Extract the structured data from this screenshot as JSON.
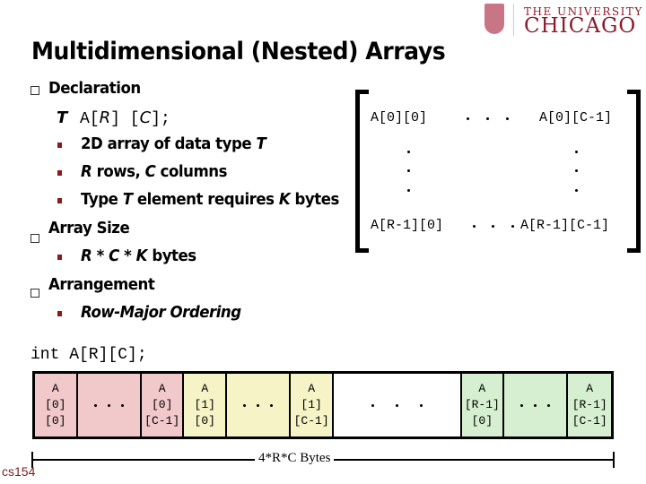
{
  "logo": {
    "top_line": "THE UNIVERSITY OF",
    "main_line": "CHICAGO",
    "brand_color": "#8b1a2e",
    "icon": "university-crest-icon"
  },
  "title": "Multidimensional (Nested) Arrays",
  "bullets": [
    {
      "label": "Declaration",
      "declaration": {
        "type": "T",
        "name": "A",
        "r": "R",
        "c": "C",
        "end": ";"
      },
      "sub": [
        {
          "text": "2D array of data type ",
          "italic": "T"
        },
        {
          "italic": "R",
          "text": " rows, ",
          "italic2": "C",
          "text2": " columns"
        },
        {
          "text": "Type ",
          "italic": "T",
          "text2": " element requires ",
          "italic2": "K",
          "text3": " bytes"
        }
      ]
    },
    {
      "label": "Array Size",
      "sub": [
        {
          "italic": "R",
          "text": " * ",
          "italic2": "C",
          "text2": " * ",
          "italic3": "K",
          "text3": " bytes"
        }
      ]
    },
    {
      "label": "Arrangement",
      "sub": [
        {
          "italic": "Row-Major Ordering"
        }
      ]
    }
  ],
  "matrix": {
    "top_left": "A[0][0]",
    "top_right": "A[0][C-1]",
    "bottom_left": "A[R-1][0]",
    "bottom_right": "A[R-1][C-1]"
  },
  "code": "int A[R][C];",
  "memory": {
    "colors": {
      "row0": "#f2c9cb",
      "row1": "#f6f3c6",
      "gap": "#ffffff",
      "rowLast": "#d6efd0"
    },
    "cells": [
      {
        "lines": [
          "A",
          "[0]",
          "[0]"
        ],
        "group": "row0"
      },
      {
        "dots": true,
        "group": "row0"
      },
      {
        "lines": [
          "A",
          "[0]",
          "[C-1]"
        ],
        "group": "row0"
      },
      {
        "lines": [
          "A",
          "[1]",
          "[0]"
        ],
        "group": "row1"
      },
      {
        "dots": true,
        "group": "row1"
      },
      {
        "lines": [
          "A",
          "[1]",
          "[C-1]"
        ],
        "group": "row1"
      },
      {
        "dots": true,
        "group": "gap"
      },
      {
        "lines": [
          "A",
          "[R-1]",
          "[0]"
        ],
        "group": "rowLast"
      },
      {
        "dots": true,
        "group": "rowLast"
      },
      {
        "lines": [
          "A",
          "[R-1]",
          "[C-1]"
        ],
        "group": "rowLast"
      }
    ],
    "size_label": "4*R*C Bytes"
  },
  "footer": "cs154"
}
